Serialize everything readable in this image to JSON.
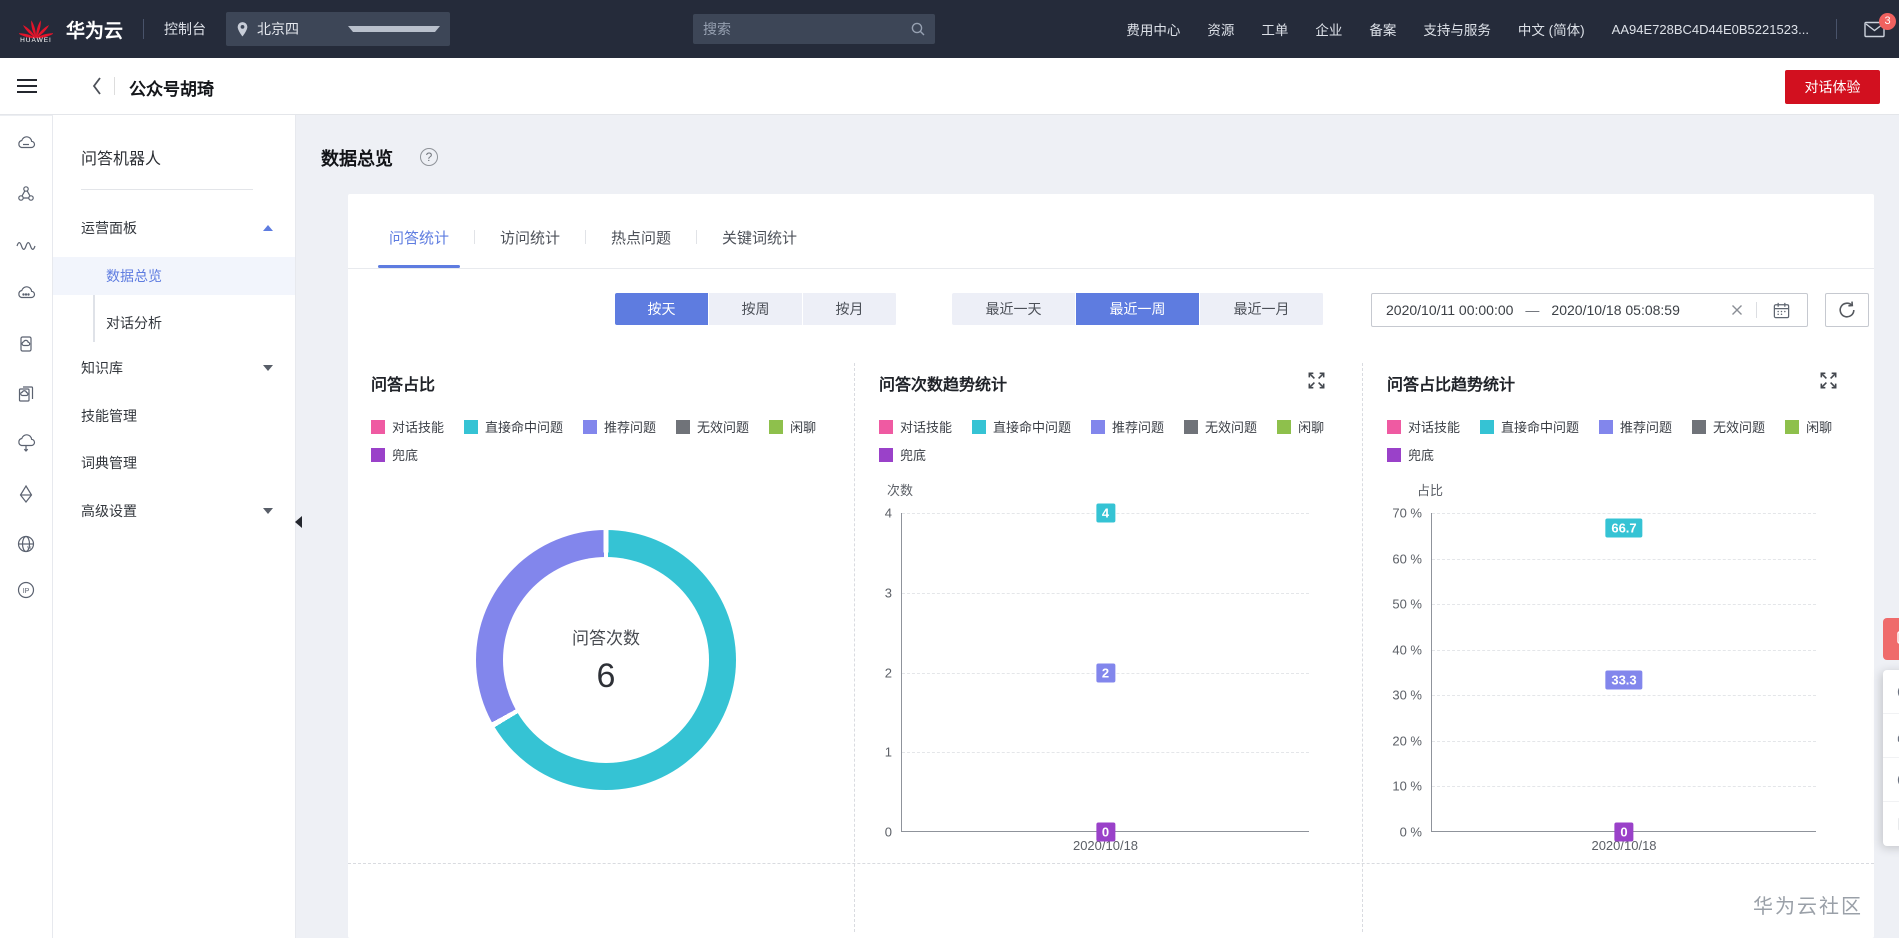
{
  "topbar": {
    "logo_text": "HUAWEI",
    "brand": "华为云",
    "console": "控制台",
    "region": "北京四",
    "search_placeholder": "搜索",
    "links": [
      "费用中心",
      "资源",
      "工单",
      "企业",
      "备案",
      "支持与服务",
      "中文 (简体)"
    ],
    "account_id": "AA94E728BC4D44E0B5221523...",
    "mail_badge": "3"
  },
  "subheader": {
    "title": "公众号胡琦",
    "action_button": "对话体验"
  },
  "sidebar": {
    "title": "问答机器人",
    "groups": [
      {
        "label": "运营面板",
        "expanded": true
      },
      {
        "label": "知识库",
        "expanded": false
      },
      {
        "label": "技能管理"
      },
      {
        "label": "词典管理"
      },
      {
        "label": "高级设置",
        "expanded": false
      }
    ],
    "sub_items": [
      {
        "label": "数据总览",
        "selected": true
      },
      {
        "label": "对话分析",
        "selected": false
      }
    ]
  },
  "page": {
    "title": "数据总览",
    "tabs": [
      {
        "label": "问答统计",
        "active": true
      },
      {
        "label": "访问统计",
        "active": false
      },
      {
        "label": "热点问题",
        "active": false
      },
      {
        "label": "关键词统计",
        "active": false
      }
    ],
    "granularity": [
      {
        "label": "按天",
        "active": true
      },
      {
        "label": "按周",
        "active": false
      },
      {
        "label": "按月",
        "active": false
      }
    ],
    "quick_range": [
      {
        "label": "最近一天",
        "active": false
      },
      {
        "label": "最近一周",
        "active": true
      },
      {
        "label": "最近一月",
        "active": false
      }
    ],
    "date_start": "2020/10/11 00:00:00",
    "date_sep": "—",
    "date_end": "2020/10/18 05:08:59"
  },
  "legend": [
    {
      "label": "对话技能",
      "color": "#ef5aa2"
    },
    {
      "label": "直接命中问题",
      "color": "#35c3d4"
    },
    {
      "label": "推荐问题",
      "color": "#8286ec"
    },
    {
      "label": "无效问题",
      "color": "#707379"
    },
    {
      "label": "闲聊",
      "color": "#8ec04c"
    },
    {
      "label": "兜底",
      "color": "#9a41c9"
    }
  ],
  "chart_data": [
    {
      "type": "pie",
      "variant": "donut",
      "title": "问答占比",
      "center_label": "问答次数",
      "center_value": "6",
      "slices": [
        {
          "name": "直接命中问题",
          "percent": 66.7,
          "color": "#35c3d4"
        },
        {
          "name": "推荐问题",
          "percent": 33.3,
          "color": "#8286ec"
        }
      ]
    },
    {
      "type": "scatter",
      "title": "问答次数趋势统计",
      "ylabel": "次数",
      "ylim": [
        0,
        4
      ],
      "yticks": [
        4,
        3,
        2,
        1,
        0
      ],
      "tick_suffix": "",
      "x": [
        "2020/10/18"
      ],
      "grid": "dashed",
      "series": [
        {
          "name": "直接命中问题",
          "value": 4,
          "label": "4",
          "color": "#35c3d4"
        },
        {
          "name": "推荐问题",
          "value": 2,
          "label": "2",
          "color": "#8286ec"
        },
        {
          "name": "兜底",
          "value": 0,
          "label": "0",
          "color": "#9a41c9"
        }
      ]
    },
    {
      "type": "scatter",
      "title": "问答占比趋势统计",
      "ylabel": "占比",
      "ylim": [
        0,
        70
      ],
      "yticks": [
        70,
        60,
        50,
        40,
        30,
        20,
        10,
        0
      ],
      "tick_suffix": " %",
      "x": [
        "2020/10/18"
      ],
      "grid": "dashed",
      "series": [
        {
          "name": "直接命中问题",
          "value": 66.7,
          "label": "66.7",
          "color": "#35c3d4"
        },
        {
          "name": "推荐问题",
          "value": 33.3,
          "label": "33.3",
          "color": "#8286ec"
        },
        {
          "name": "兜底",
          "value": 0,
          "label": "0",
          "color": "#9a41c9"
        }
      ]
    }
  ],
  "watermark": "华为云社区",
  "colors": {
    "primary": "#5e7ce0",
    "action_red": "#d2101f",
    "badge_red": "#f0615f",
    "topbar_bg": "#252b3a"
  }
}
